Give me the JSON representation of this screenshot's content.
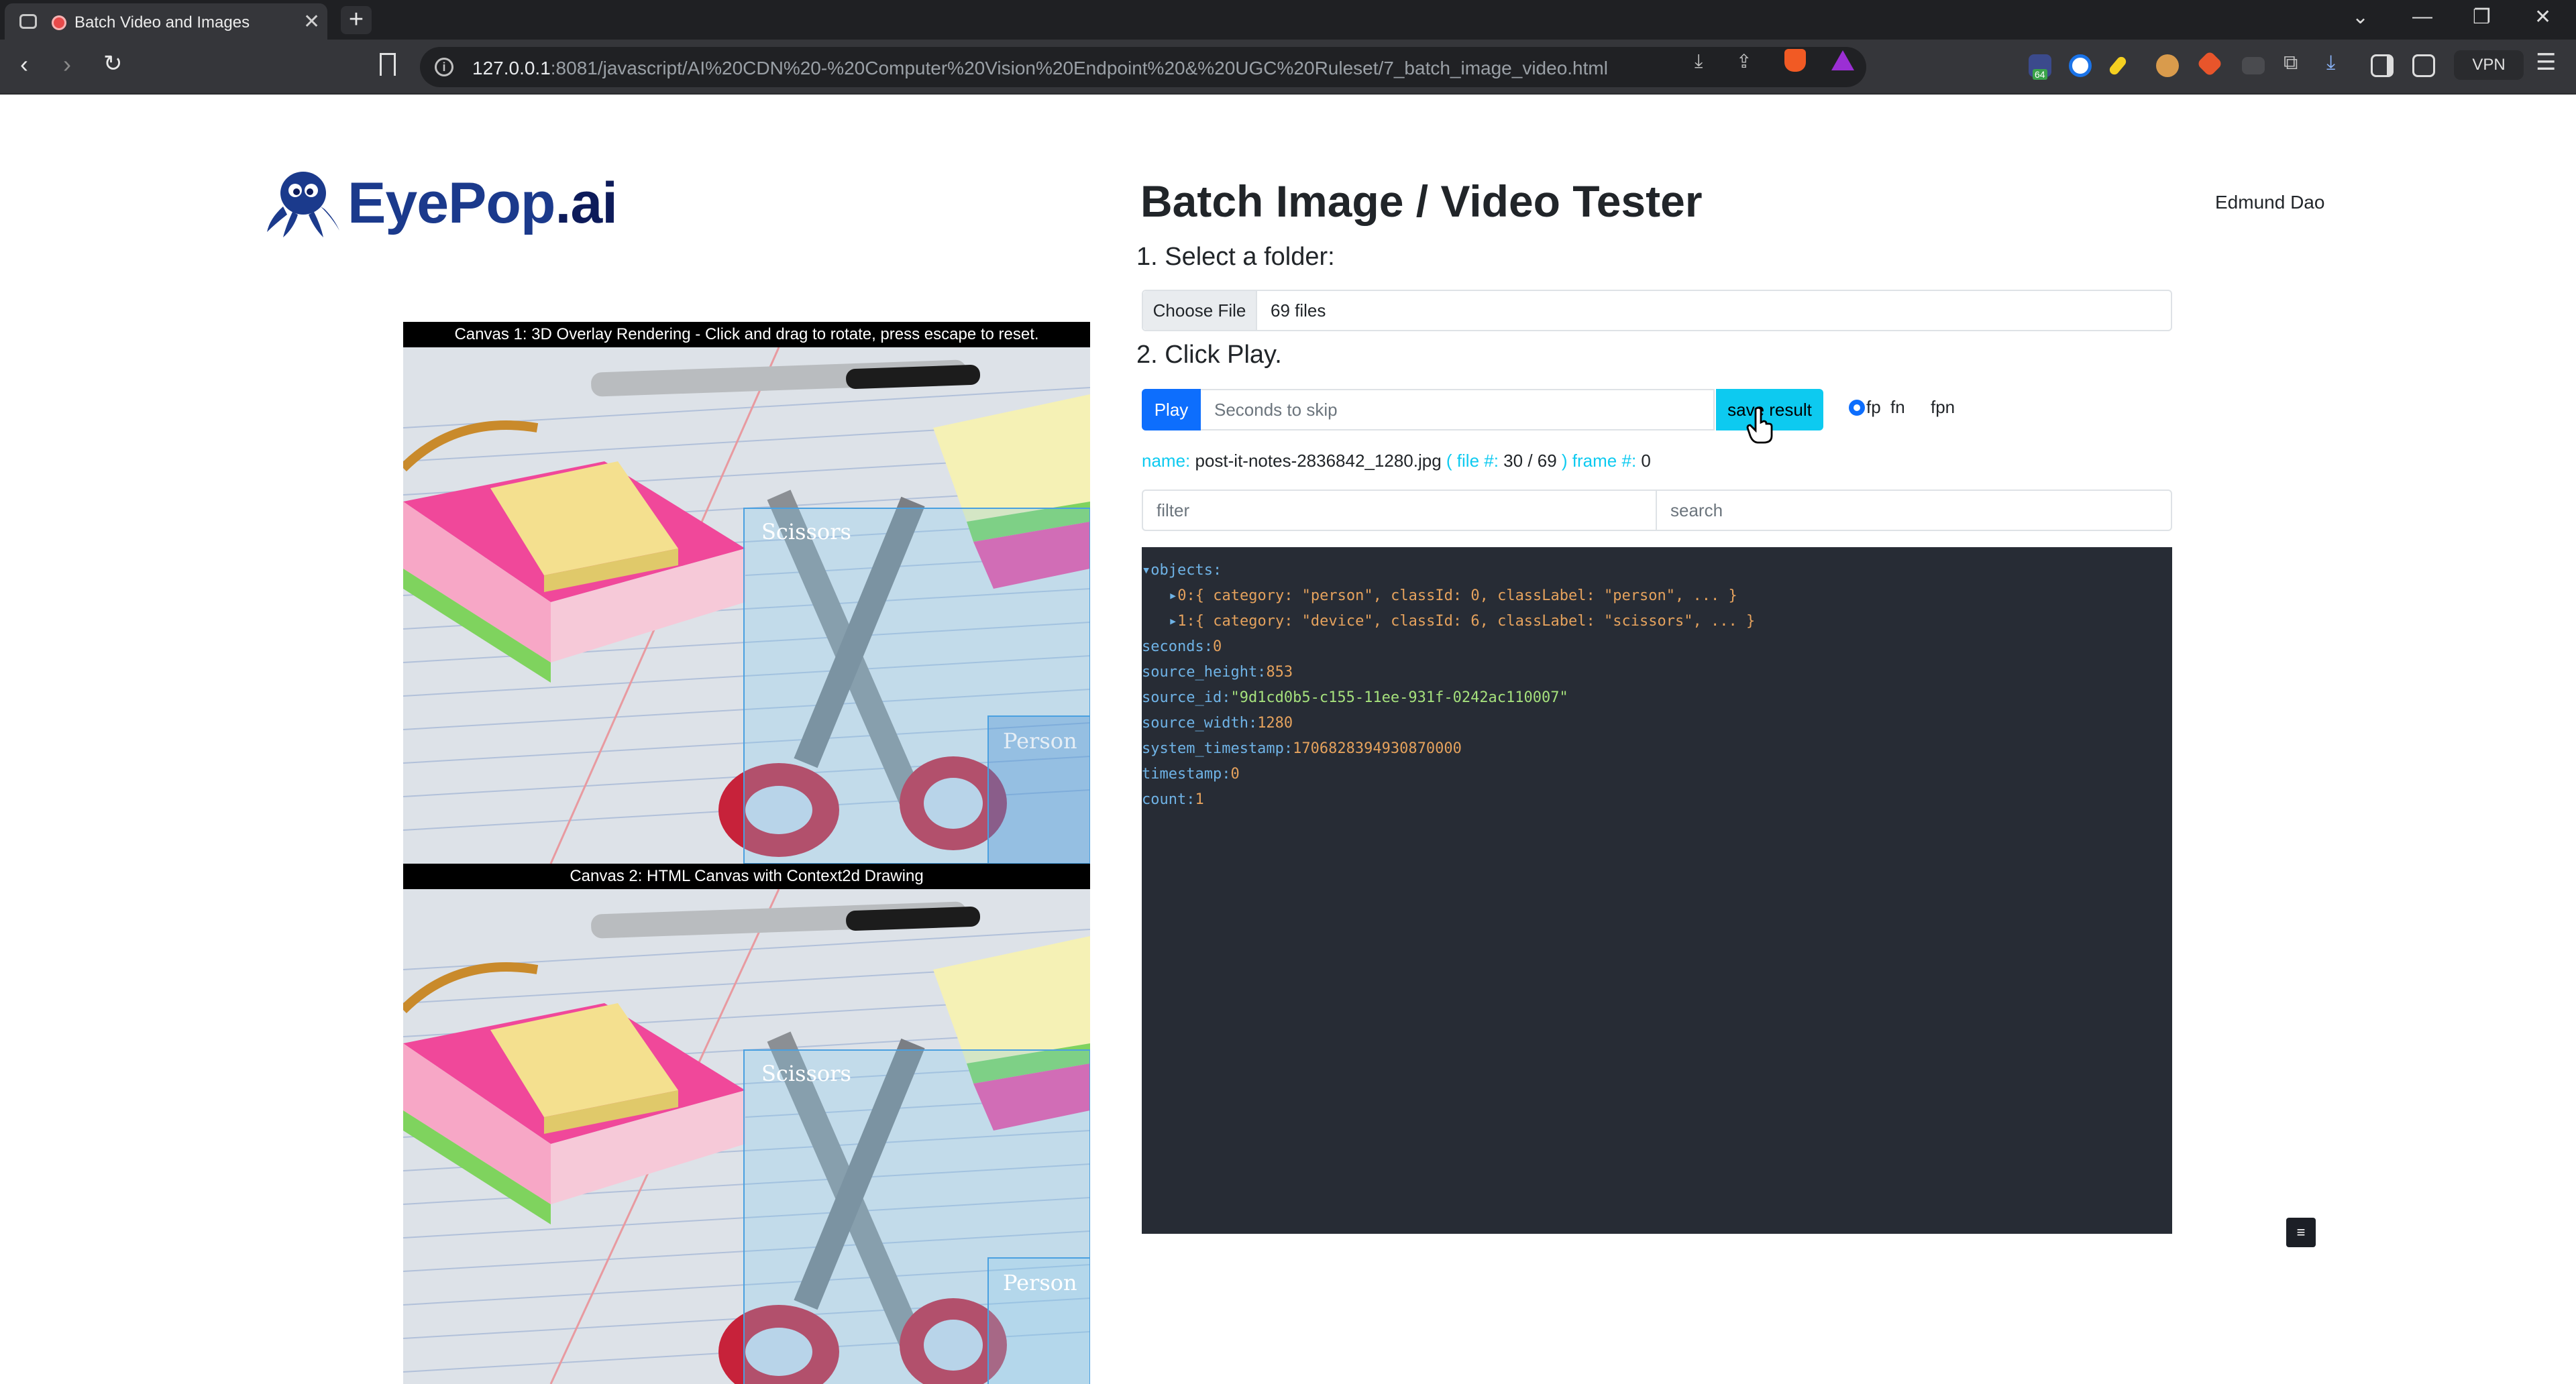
{
  "browser": {
    "tab_title": "Batch Video and Images",
    "new_tab": "+",
    "url_host": "127.0.0.1",
    "url_rest": ":8081/javascript/AI%20CDN%20-%20Computer%20Vision%20Endpoint%20&%20UGC%20Ruleset/7_batch_image_video.html",
    "ext_badge": "64",
    "vpn_label": "VPN"
  },
  "header": {
    "logo_eye": "EyePop",
    "logo_ai": ".ai",
    "title": "Batch Image / Video Tester",
    "user": "Edmund Dao"
  },
  "canvases": {
    "canvas1_caption": "Canvas 1: 3D Overlay Rendering - Click and drag to rotate, press escape to reset.",
    "canvas2_caption": "Canvas 2: HTML Canvas with Context2d Drawing",
    "label_scissors": "Scissors",
    "label_person": "Person"
  },
  "steps": {
    "step1": "1. Select a folder:",
    "step2": "2. Click Play."
  },
  "file_input": {
    "button": "Choose File",
    "value": "69 files"
  },
  "controls": {
    "play": "Play",
    "seconds_placeholder": "Seconds to skip",
    "save_result": "save result",
    "radio_fp": "fp",
    "radio_fn": "fn",
    "radio_fpn": "fpn",
    "selected_radio": "fp"
  },
  "status": {
    "name_label": "name:",
    "name_value": "post-it-notes-2836842_1280.jpg",
    "file_label": "( file #:",
    "file_value": "30 / 69",
    "frame_label": ") frame #:",
    "frame_value": "0"
  },
  "filter": {
    "filter_placeholder": "filter",
    "search_placeholder": "search"
  },
  "json_view": {
    "objects_key": "objects:",
    "obj0": "0:{ category: \"person\", classId: 0, classLabel: \"person\", ... }",
    "obj1": "1:{ category: \"device\", classId: 6, classLabel: \"scissors\", ... }",
    "seconds_key": "seconds:",
    "seconds_val": "0",
    "source_height_key": "source_height:",
    "source_height_val": "853",
    "source_id_key": "source_id:",
    "source_id_val": "\"9d1cd0b5-c155-11ee-931f-0242ac110007\"",
    "source_width_key": "source_width:",
    "source_width_val": "1280",
    "system_timestamp_key": "system_timestamp:",
    "system_timestamp_val": "1706828394930870000",
    "timestamp_key": "timestamp:",
    "timestamp_val": "0",
    "count_key": "count:",
    "count_val": "1"
  },
  "colors": {
    "primary": "#0d6efd",
    "info": "#0dcaf0",
    "json_bg": "#272c35",
    "detection_box": "#4aa0e0"
  }
}
